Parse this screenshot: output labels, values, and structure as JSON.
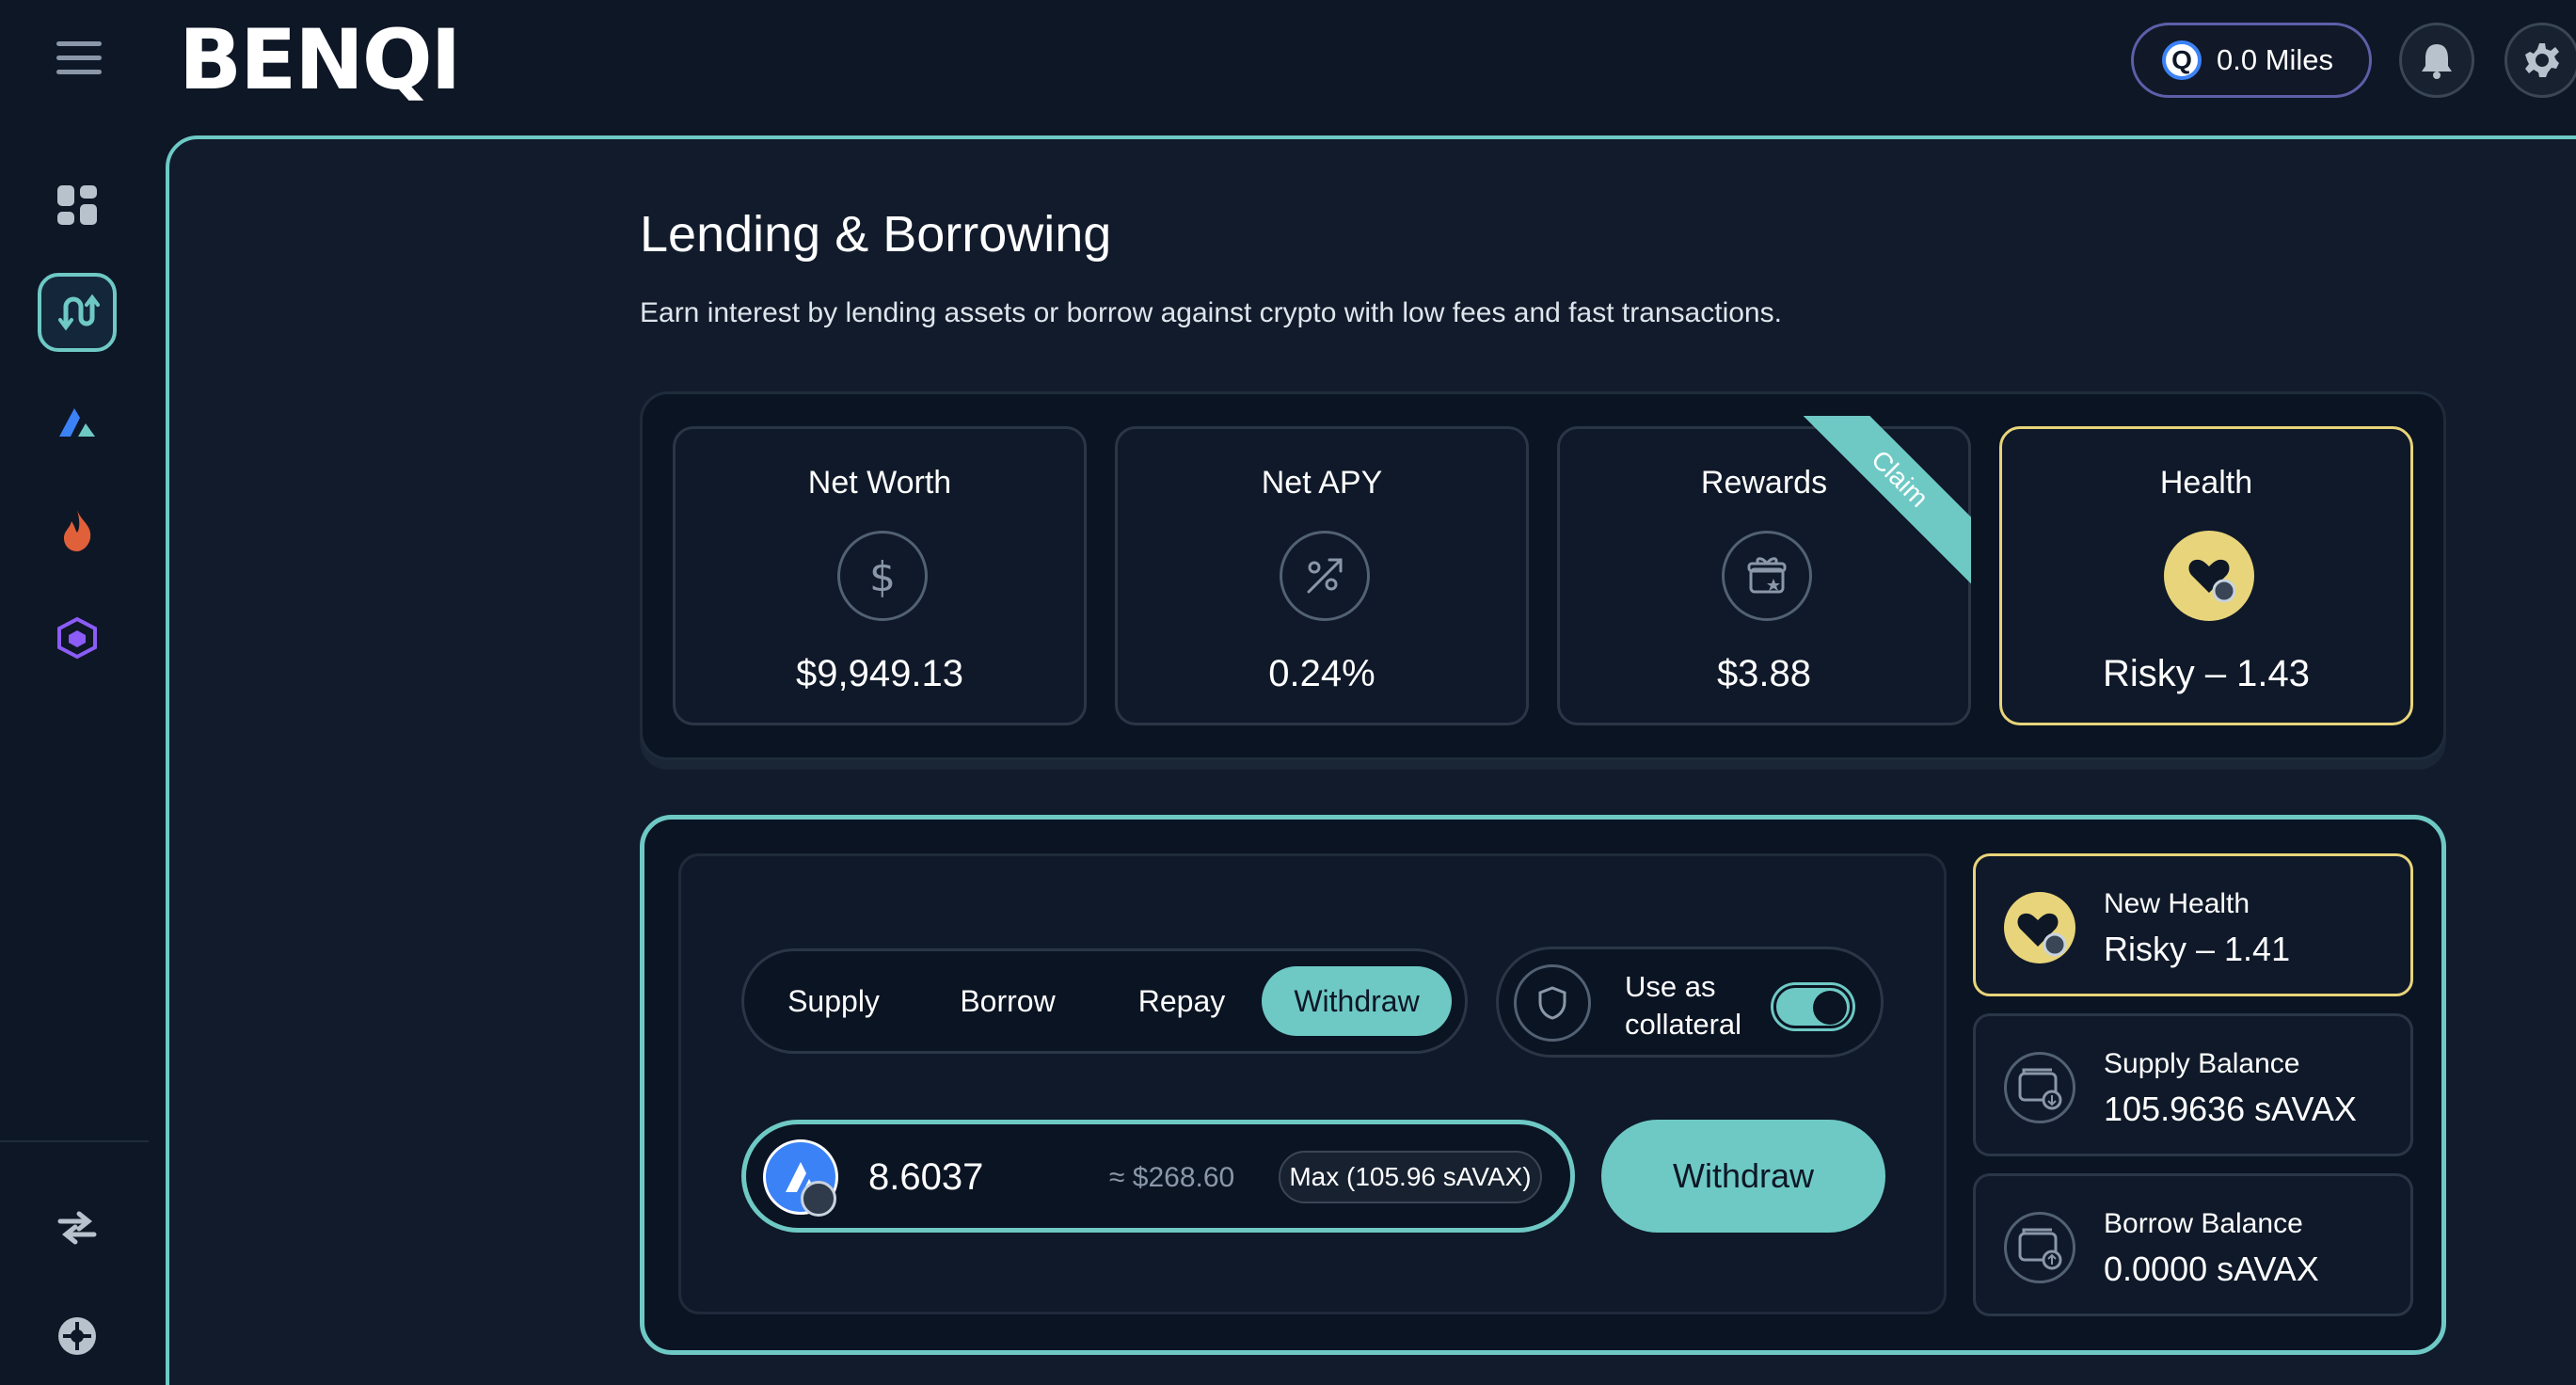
{
  "brand": {
    "logo_text": "BENQI",
    "accent": "#6ec9c5",
    "health_accent": "#e8d47a"
  },
  "header": {
    "miles_label": "0.0 Miles"
  },
  "sidebar": {
    "items": [
      {
        "name": "dashboard",
        "icon": "dashboard-icon"
      },
      {
        "name": "lending",
        "icon": "lending-icon",
        "active": true
      },
      {
        "name": "liquid-staking",
        "icon": "avalanche-icon"
      },
      {
        "name": "ignite",
        "icon": "flame-icon"
      },
      {
        "name": "ecosystem",
        "icon": "cube-icon"
      }
    ],
    "bottom": [
      {
        "name": "swap",
        "icon": "swap-icon"
      },
      {
        "name": "community",
        "icon": "globe-icon"
      }
    ]
  },
  "page": {
    "title": "Lending & Borrowing",
    "subtitle": "Earn interest by lending assets or borrow against crypto with low fees and fast transactions."
  },
  "stats": {
    "net_worth": {
      "label": "Net Worth",
      "value": "$9,949.13"
    },
    "net_apy": {
      "label": "Net APY",
      "value": "0.24%"
    },
    "rewards": {
      "label": "Rewards",
      "value": "$3.88",
      "ribbon": "Claim"
    },
    "health": {
      "label": "Health",
      "value": "Risky – 1.43"
    }
  },
  "form": {
    "tabs": [
      {
        "label": "Supply"
      },
      {
        "label": "Borrow"
      },
      {
        "label": "Repay"
      },
      {
        "label": "Withdraw",
        "active": true
      }
    ],
    "collateral": {
      "label": "Use as collateral",
      "enabled": true
    },
    "amount": {
      "value": "8.6037",
      "usd": "≈ $268.60",
      "max_label": "Max (105.96 sAVAX)",
      "asset": "sAVAX"
    },
    "submit_label": "Withdraw"
  },
  "info": {
    "new_health": {
      "label": "New Health",
      "value": "Risky – 1.41"
    },
    "supply_balance": {
      "label": "Supply Balance",
      "value": "105.9636 sAVAX"
    },
    "borrow_balance": {
      "label": "Borrow Balance",
      "value": "0.0000 sAVAX"
    }
  }
}
